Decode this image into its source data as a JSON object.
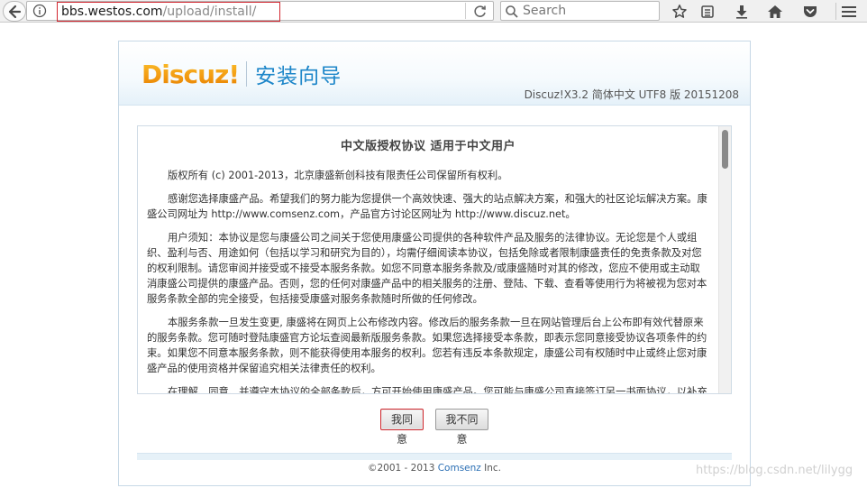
{
  "browser": {
    "url_host": "bbs.westos.com",
    "url_path": "/upload/install/",
    "search_placeholder": "Search",
    "icons": [
      "back-arrow-icon",
      "info-icon",
      "dropdown-icon",
      "reload-icon",
      "search-icon",
      "bookmark-star-icon",
      "reading-list-icon",
      "download-icon",
      "home-icon",
      "pocket-icon",
      "hamburger-menu-icon"
    ]
  },
  "header": {
    "logo": "Discuz!",
    "title": "安装向导",
    "version": "Discuz!X3.2 简体中文 UTF8 版 20151208"
  },
  "license": {
    "title": "中文版授权协议 适用于中文用户",
    "paragraphs": [
      "版权所有 (c) 2001-2013，北京康盛新创科技有限责任公司保留所有权利。",
      "感谢您选择康盛产品。希望我们的努力能为您提供一个高效快速、强大的站点解决方案，和强大的社区论坛解决方案。康盛公司网址为 http://www.comsenz.com，产品官方讨论区网址为 http://www.discuz.net。",
      "用户须知：本协议是您与康盛公司之间关于您使用康盛公司提供的各种软件产品及服务的法律协议。无论您是个人或组织、盈利与否、用途如何（包括以学习和研究为目的），均需仔细阅读本协议，包括免除或者限制康盛责任的免责条款及对您的权利限制。请您审阅并接受或不接受本服务条款。如您不同意本服务条款及/或康盛随时对其的修改，您应不使用或主动取消康盛公司提供的康盛产品。否则，您的任何对康盛产品中的相关服务的注册、登陆、下载、查看等使用行为将被视为您对本服务条款全部的完全接受，包括接受康盛对服务条款随时所做的任何修改。",
      "本服务条款一旦发生变更, 康盛将在网页上公布修改内容。修改后的服务条款一旦在网站管理后台上公布即有效代替原来的服务条款。您可随时登陆康盛官方论坛查阅最新版服务条款。如果您选择接受本条款，即表示您同意接受协议各项条件的约束。如果您不同意本服务条款，则不能获得使用本服务的权利。您若有违反本条款规定，康盛公司有权随时中止或终止您对康盛产品的使用资格并保留追究相关法律责任的权利。",
      "在理解、同意、并遵守本协议的全部条款后，方可开始使用康盛产品。您可能与康盛公司直接签订另一书面协议，以补充或者取代本协议的全部或者任何部分。"
    ]
  },
  "buttons": {
    "agree": "我同意",
    "disagree": "我不同意"
  },
  "footer": {
    "prefix": "©2001 - 2013 ",
    "brand": "Comsenz",
    "suffix": " Inc."
  },
  "watermark": "https://blog.csdn.net/lilygg",
  "colors": {
    "accent_blue": "#1d86c9",
    "logo_orange": "#f4a008",
    "focus_red": "#d0282e"
  }
}
